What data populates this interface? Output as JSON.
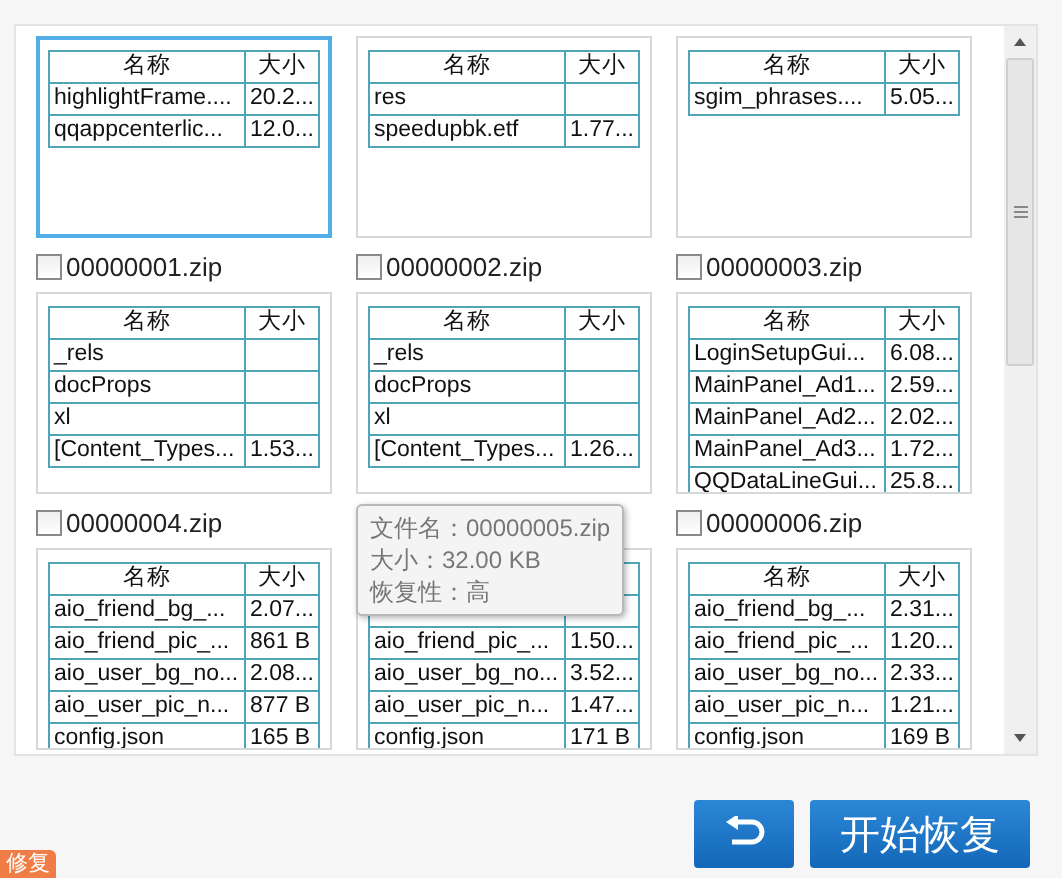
{
  "card_rows": [
    {
      "cards": [
        {
          "selected": true,
          "columns": [
            "名称",
            "大小"
          ],
          "rows": [
            [
              "highlightFrame....",
              "20.2..."
            ],
            [
              "qqappcenterlic...",
              "12.0..."
            ]
          ],
          "file": {
            "name": "00000001.zip",
            "checked": false
          }
        },
        {
          "selected": false,
          "columns": [
            "名称",
            "大小"
          ],
          "rows": [
            [
              "res",
              ""
            ],
            [
              "speedupbk.etf",
              "1.77..."
            ]
          ],
          "file": {
            "name": "00000002.zip",
            "checked": false
          }
        },
        {
          "selected": false,
          "columns": [
            "名称",
            "大小"
          ],
          "rows": [
            [
              "sgim_phrases....",
              "5.05..."
            ]
          ],
          "file": {
            "name": "00000003.zip",
            "checked": false
          }
        }
      ]
    },
    {
      "cards": [
        {
          "selected": false,
          "columns": [
            "名称",
            "大小"
          ],
          "rows": [
            [
              "_rels",
              ""
            ],
            [
              "docProps",
              ""
            ],
            [
              "xl",
              ""
            ],
            [
              "[Content_Types...",
              "1.53..."
            ]
          ],
          "file": {
            "name": "00000004.zip",
            "checked": false
          }
        },
        {
          "selected": false,
          "columns": [
            "名称",
            "大小"
          ],
          "rows": [
            [
              "_rels",
              ""
            ],
            [
              "docProps",
              ""
            ],
            [
              "xl",
              ""
            ],
            [
              "[Content_Types...",
              "1.26..."
            ]
          ]
        },
        {
          "selected": false,
          "columns": [
            "名称",
            "大小"
          ],
          "rows": [
            [
              "LoginSetupGui...",
              "6.08..."
            ],
            [
              "MainPanel_Ad1...",
              "2.59..."
            ],
            [
              "MainPanel_Ad2...",
              "2.02..."
            ],
            [
              "MainPanel_Ad3...",
              "1.72..."
            ],
            [
              "QQDataLineGui...",
              "25.8..."
            ]
          ],
          "file": {
            "name": "00000006.zip",
            "checked": false
          }
        }
      ]
    },
    {
      "cards": [
        {
          "selected": false,
          "columns": [
            "名称",
            "大小"
          ],
          "rows": [
            [
              "aio_friend_bg_...",
              "2.07..."
            ],
            [
              "aio_friend_pic_...",
              "861 B"
            ],
            [
              "aio_user_bg_no...",
              "2.08..."
            ],
            [
              "aio_user_pic_n...",
              "877 B"
            ],
            [
              "config.json",
              "165 B"
            ]
          ]
        },
        {
          "selected": false,
          "rows": [
            [
              "aio_friend_pic_...",
              "1.50..."
            ],
            [
              "aio_user_bg_no...",
              "3.52..."
            ],
            [
              "aio_user_pic_n...",
              "1.47..."
            ],
            [
              "config.json",
              "171 B"
            ]
          ]
        },
        {
          "selected": false,
          "columns": [
            "名称",
            "大小"
          ],
          "rows": [
            [
              "aio_friend_bg_...",
              "2.31..."
            ],
            [
              "aio_friend_pic_...",
              "1.20..."
            ],
            [
              "aio_user_bg_no...",
              "2.33..."
            ],
            [
              "aio_user_pic_n...",
              "1.21..."
            ],
            [
              "config.json",
              "169 B"
            ]
          ]
        }
      ]
    }
  ],
  "tooltip": {
    "lines": [
      "文件名：00000005.zip",
      "大小：32.00 KB",
      "恢复性：高"
    ]
  },
  "buttons": [
    {
      "kind": "back"
    },
    {
      "kind": "text",
      "label": "开始恢复"
    }
  ],
  "badge": "修复"
}
